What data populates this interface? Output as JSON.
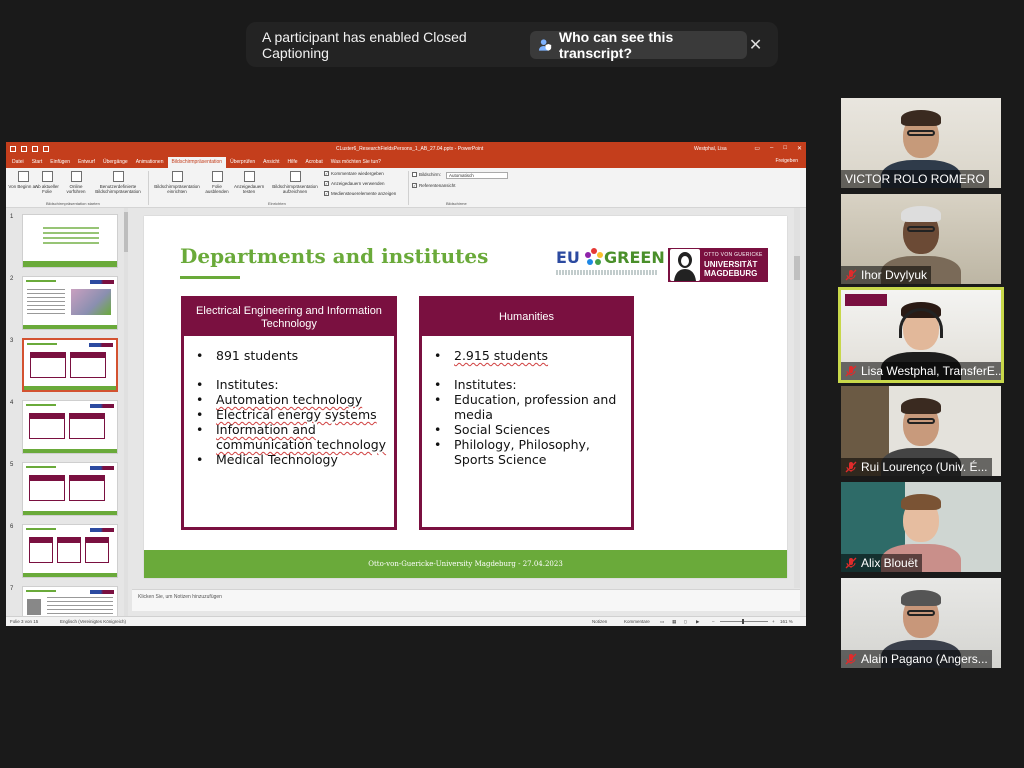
{
  "banner": {
    "message": "A participant has enabled Closed Captioning",
    "button_label": "Who can see this transcript?",
    "close_glyph": "✕"
  },
  "ppt": {
    "file_name": "CLuster6_ResearchFieldsPersons_1_AB_27.04.pptx  -  PowerPoint",
    "user": "Westphal, Lisa",
    "menu": [
      "Datei",
      "Start",
      "Einfügen",
      "Entwurf",
      "Übergänge",
      "Animationen",
      "Bildschirmpräsentation",
      "Überprüfen",
      "Ansicht",
      "Hilfe",
      "Acrobat",
      "Was möchten Sie tun?"
    ],
    "active_menu_index": 6,
    "share_label": "Freigeben",
    "ribbon": {
      "from_start": "Von Beginn an",
      "from_current": "Ab aktueller Folie",
      "online": "Online vorführen",
      "custom": "Benutzerdefinierte Bildschirmpräsentation",
      "group_start": "Bildschirmpräsentation starten",
      "setup": "Bildschirmpräsentation einrichten",
      "hide_slide": "Folie ausblenden",
      "rehearse": "Anzeigedauern testen",
      "record": "Bildschirmpräsentation aufzeichnen",
      "check_comments": "Kommentare wiedergeben",
      "check_timings": "Anzeigedauern verwenden",
      "check_media": "Mediensteuerelemente anzeigen",
      "group_setup": "Einrichten",
      "monitor_label": "Bildschirm:",
      "monitor_value": "Automatisch",
      "presenter_view": "Referentenansicht",
      "group_monitors": "Bildschirme"
    },
    "thumb_numbers": [
      "1",
      "2",
      "3",
      "4",
      "5",
      "6",
      "7"
    ],
    "selected_thumb": 3,
    "notes_placeholder": "Klicken Sie, um Notizen hinzuzufügen",
    "status": {
      "slide_of": "Folie 3 von 15",
      "language": "Englisch (Vereinigtes Königreich)",
      "notes": "Notizen",
      "comments": "Kommentare",
      "zoom": "161 %"
    }
  },
  "slide": {
    "title": "Departments and institutes",
    "logo_eu": "EU",
    "logo_green": "GREEN",
    "logo_ovgu_top": "OTTO VON GUERICKE",
    "logo_ovgu_line1": "UNIVERSITÄT",
    "logo_ovgu_line2": "MAGDEBURG",
    "card1": {
      "header": "Electrical Engineering and Information Technology",
      "students": "891 students",
      "institutes_label": "Institutes:",
      "items": [
        "Automation technology",
        "Electrical energy systems",
        "Information and communication technology",
        "Medical Technology"
      ]
    },
    "card2": {
      "header": "Humanities",
      "students": "2.915 students",
      "institutes_label": "Institutes:",
      "items": [
        "Education, profession and media",
        "Social Sciences",
        "Philology, Philosophy, Sports Science"
      ]
    },
    "footer": "Otto-von-Guericke-University Magdeburg - 27.04.2023"
  },
  "participants": [
    {
      "name": "VICTOR ROLO ROMERO"
    },
    {
      "name": "Ihor Dvylyuk"
    },
    {
      "name": "Lisa Westphal, TransferE..."
    },
    {
      "name": "Rui Lourenço (Univ. É..."
    },
    {
      "name": "Alix Blouët"
    },
    {
      "name": "Alain Pagano (Angers..."
    }
  ],
  "colors": {
    "ppt_accent": "#c43e1c",
    "slide_green": "#6aaa3a",
    "ovgu_purple": "#7a1040",
    "active_speaker": "#c8d84a",
    "muted_red": "#e02b2b"
  }
}
